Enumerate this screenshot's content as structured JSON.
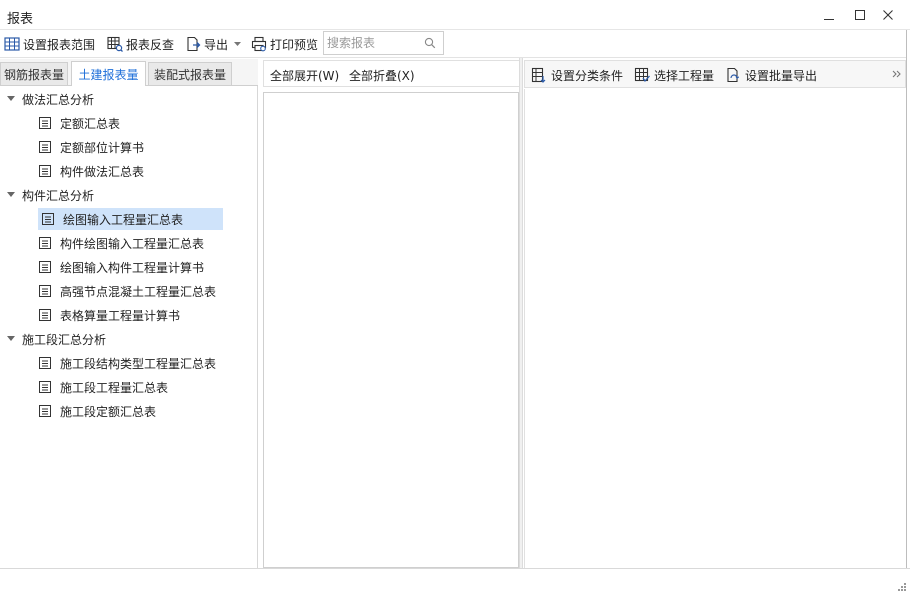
{
  "window": {
    "title": "报表",
    "minimize_icon": "minimize-icon",
    "maximize_icon": "maximize-icon",
    "close_icon": "close-icon"
  },
  "toolbar": {
    "set_range": {
      "label": "设置报表范围",
      "icon": "grid-settings-icon"
    },
    "reverse_check": {
      "label": "报表反查",
      "icon": "table-search-icon"
    },
    "export": {
      "label": "导出",
      "icon": "export-icon"
    },
    "print_preview": {
      "label": "打印预览",
      "icon": "printer-icon"
    },
    "search": {
      "placeholder": "搜索报表",
      "icon": "search-icon"
    }
  },
  "left_panel": {
    "tabs": [
      {
        "label": "钢筋报表量",
        "active": false
      },
      {
        "label": "土建报表量",
        "active": true
      },
      {
        "label": "装配式报表量",
        "active": false
      }
    ],
    "tree": [
      {
        "label": "做法汇总分析",
        "expanded": true,
        "children": [
          {
            "label": "定额汇总表"
          },
          {
            "label": "定额部位计算书"
          },
          {
            "label": "构件做法汇总表"
          }
        ]
      },
      {
        "label": "构件汇总分析",
        "expanded": true,
        "children": [
          {
            "label": "绘图输入工程量汇总表",
            "selected": true
          },
          {
            "label": "构件绘图输入工程量汇总表"
          },
          {
            "label": "绘图输入构件工程量计算书"
          },
          {
            "label": "高强节点混凝土工程量汇总表"
          },
          {
            "label": "表格算量工程量计算书"
          }
        ]
      },
      {
        "label": "施工段汇总分析",
        "expanded": true,
        "children": [
          {
            "label": "施工段结构类型工程量汇总表"
          },
          {
            "label": "施工段工程量汇总表"
          },
          {
            "label": "施工段定额汇总表"
          }
        ]
      }
    ]
  },
  "middle_panel": {
    "expand_all": "全部展开(W)",
    "collapse_all": "全部折叠(X)"
  },
  "right_panel": {
    "set_category": {
      "label": "设置分类条件",
      "icon": "category-settings-icon"
    },
    "select_quantity": {
      "label": "选择工程量",
      "icon": "table-select-icon"
    },
    "batch_export": {
      "label": "设置批量导出",
      "icon": "batch-export-icon"
    },
    "more_icon": "chevron-double-right-icon"
  },
  "colors": {
    "accent": "#1e6fd9",
    "selection": "#cfe3fa"
  }
}
